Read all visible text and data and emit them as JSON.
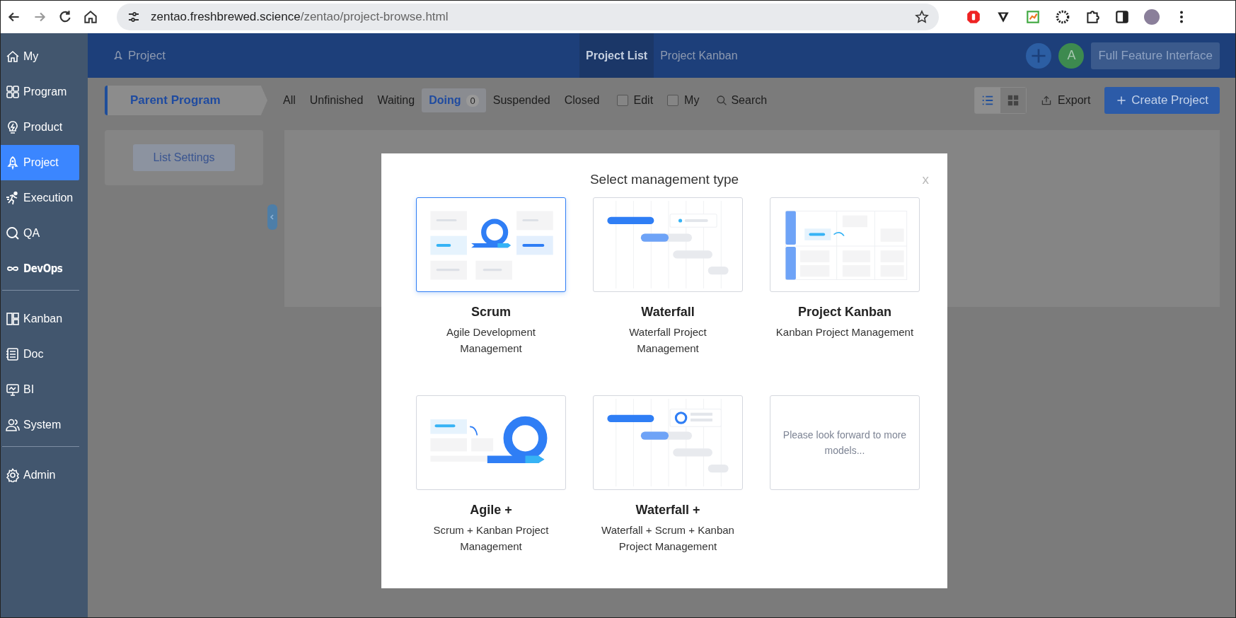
{
  "browser": {
    "url_host": "zentao.freshbrewed.science",
    "url_path": "/zentao/project-browse.html"
  },
  "sidebar": {
    "groups": [
      [
        {
          "label": "My",
          "selected": false
        },
        {
          "label": "Program",
          "selected": false
        },
        {
          "label": "Product",
          "selected": false
        },
        {
          "label": "Project",
          "selected": true
        },
        {
          "label": "Execution",
          "selected": false
        },
        {
          "label": "QA",
          "selected": false
        },
        {
          "label": "DevOps",
          "selected": false
        }
      ],
      [
        {
          "label": "Kanban",
          "selected": false
        },
        {
          "label": "Doc",
          "selected": false
        },
        {
          "label": "BI",
          "selected": false
        },
        {
          "label": "System",
          "selected": false
        }
      ],
      [
        {
          "label": "Admin",
          "selected": false
        }
      ]
    ]
  },
  "header": {
    "breadcrumb": "Project",
    "nav": [
      {
        "label": "Project List",
        "selected": true
      },
      {
        "label": "Project Kanban",
        "selected": false
      }
    ],
    "avatar": "A",
    "full_feature_button": "Full Feature Interface"
  },
  "toolbar": {
    "parent_program": "Parent Program",
    "filters": [
      {
        "label": "All",
        "selected": false
      },
      {
        "label": "Unfinished",
        "selected": false
      },
      {
        "label": "Waiting",
        "selected": false
      },
      {
        "label": "Doing",
        "selected": true,
        "count": "0"
      },
      {
        "label": "Suspended",
        "selected": false
      },
      {
        "label": "Closed",
        "selected": false
      }
    ],
    "checkboxes": [
      {
        "label": "Edit",
        "checked": false
      },
      {
        "label": "My",
        "checked": false
      }
    ],
    "search": "Search",
    "views": [
      {
        "kind": "list",
        "selected": true
      },
      {
        "kind": "grid",
        "selected": false
      }
    ],
    "export": "Export",
    "create": "Create Project"
  },
  "side_panel": {
    "list_settings": "List Settings"
  },
  "modal": {
    "title": "Select management type",
    "close": "x",
    "options": [
      {
        "kind": "scrum",
        "title": "Scrum",
        "description": "Agile Development Management",
        "selected": true
      },
      {
        "kind": "waterfall",
        "title": "Waterfall",
        "description": "Waterfall Project Management",
        "selected": false
      },
      {
        "kind": "kanban",
        "title": "Project Kanban",
        "description": "Kanban Project Management",
        "selected": false
      },
      {
        "kind": "agile",
        "title": "Agile +",
        "description": "Scrum + Kanban Project Management",
        "selected": false
      },
      {
        "kind": "waterfallplus",
        "title": "Waterfall +",
        "description": "Waterfall + Scrum + Kanban Project Management",
        "selected": false
      },
      {
        "kind": "placeholder",
        "text": "Please look forward to more models...",
        "selected": false
      }
    ]
  }
}
